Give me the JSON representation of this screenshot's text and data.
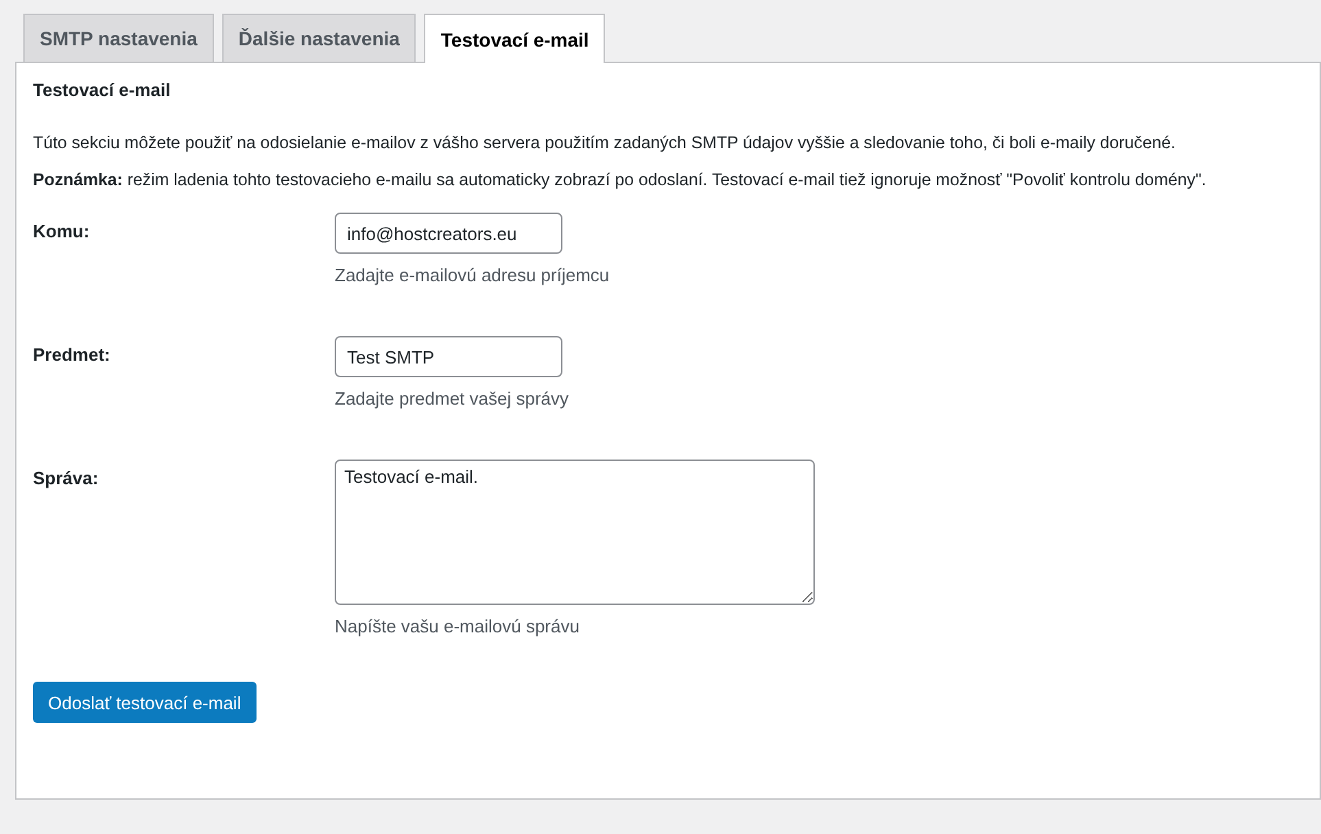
{
  "tabs": [
    {
      "label": "SMTP nastavenia",
      "selected": false
    },
    {
      "label": "Ďalšie nastavenia",
      "selected": false
    },
    {
      "label": "Testovací e-mail",
      "selected": true
    }
  ],
  "panel": {
    "title": "Testovací e-mail",
    "paragraphs": [
      "Túto sekciu môžete použiť na odosielanie e-mailov z vášho servera použitím zadaných SMTP údajov vyššie a sledovanie toho, či boli e-maily doručené.",
      "**Poznámka:** režim ladenia tohto testovacieho e-mailu sa automaticky zobrazí po odoslaní. Testovací e-mail tiež ignoruje možnosť \"Povoliť kontrolu domény\"."
    ],
    "fields": [
      {
        "label": "Komu:",
        "kind": "text",
        "value": "info@hostcreators.eu",
        "hint": "Zadajte e-mailovú adresu príjemcu"
      },
      {
        "label": "Predmet:",
        "kind": "text",
        "value": "Test SMTP",
        "hint": "Zadajte predmet vašej správy"
      },
      {
        "label": "Správa:",
        "kind": "textarea",
        "value": "Testovací e-mail.",
        "hint": "Napíšte vašu e-mailovú správu"
      }
    ],
    "submit": "Odoslať testovací e-mail"
  }
}
